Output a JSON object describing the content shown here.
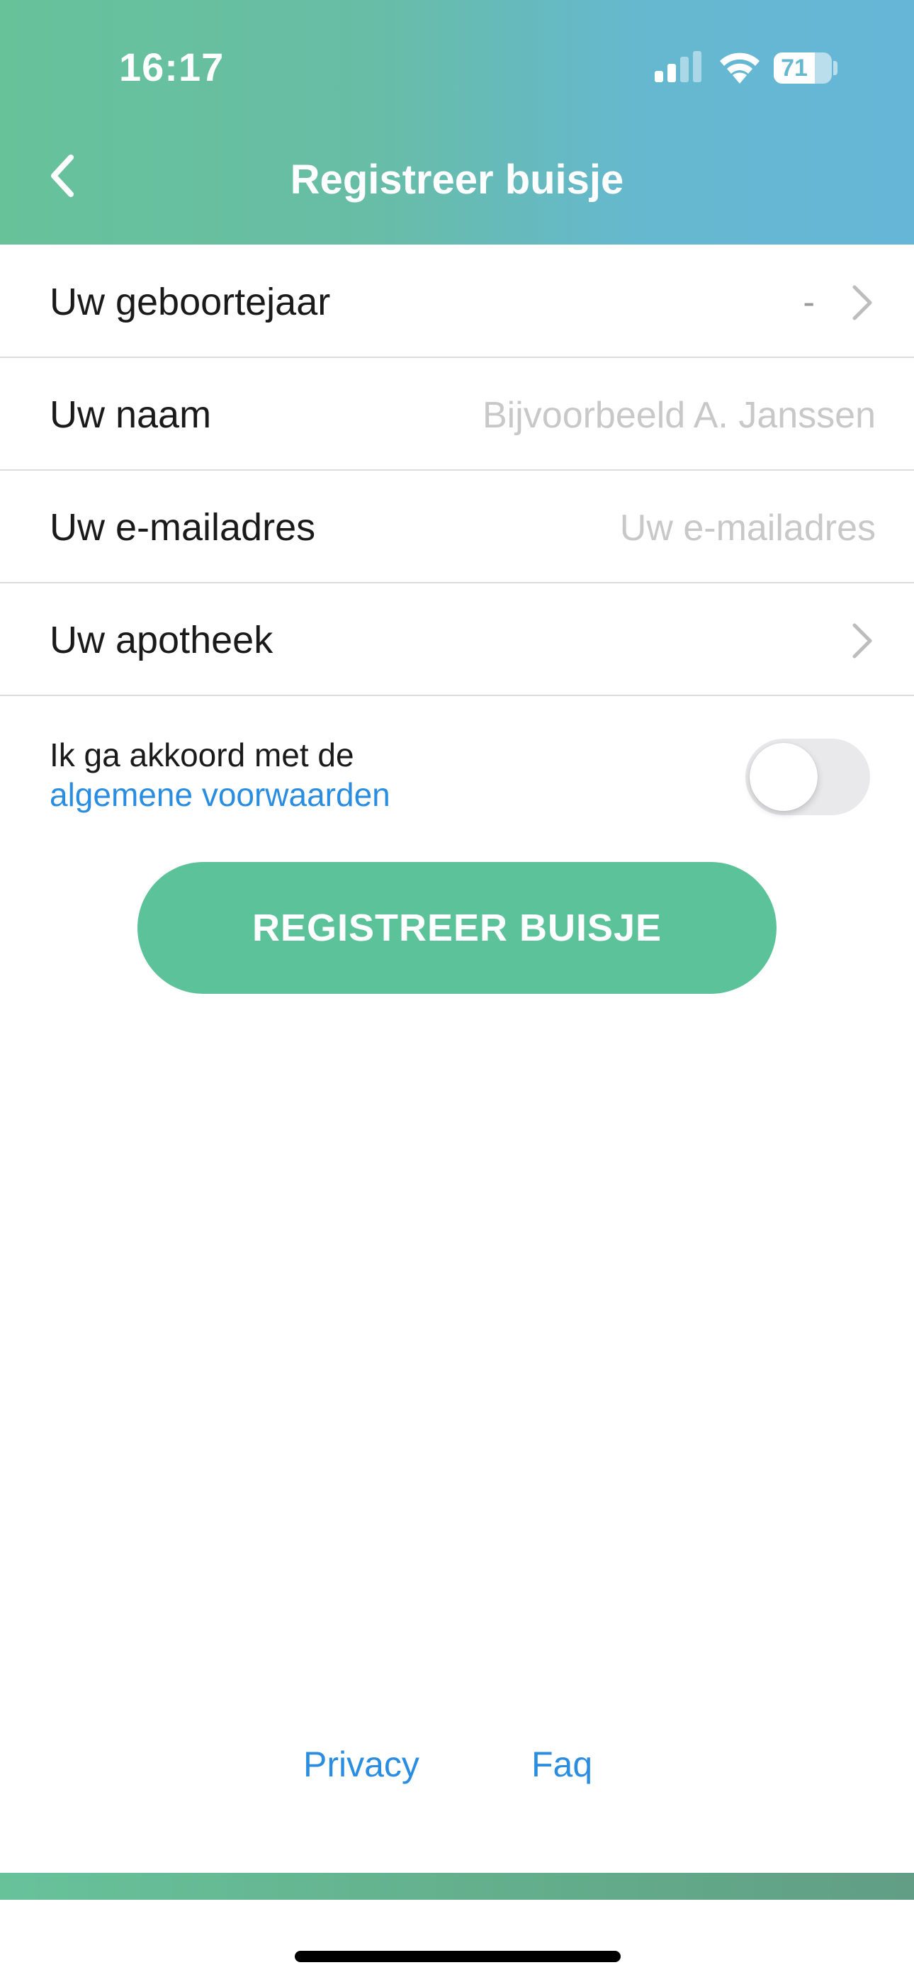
{
  "status_bar": {
    "time": "16:17",
    "battery": "71",
    "icons": [
      "signal-icon",
      "wifi-icon",
      "battery-icon"
    ]
  },
  "header": {
    "title": "Registreer buisje",
    "back_icon": "chevron-left-icon",
    "gradient_colors": [
      "#67c29a",
      "#66b6d8"
    ]
  },
  "form": {
    "birth_year": {
      "label": "Uw geboortejaar",
      "value": "-"
    },
    "name": {
      "label": "Uw naam",
      "placeholder": "Bijvoorbeeld A. Janssen",
      "value": ""
    },
    "email": {
      "label": "Uw e-mailadres",
      "placeholder": "Uw e-mailadres",
      "value": ""
    },
    "pharmacy": {
      "label": "Uw apotheek",
      "value": ""
    }
  },
  "terms": {
    "text": "Ik ga akkoord met de",
    "link": "algemene voorwaarden",
    "accepted": false
  },
  "register_button": {
    "label": "REGISTREER BUISJE",
    "color": "#5bc29a"
  },
  "footer": {
    "privacy": "Privacy",
    "faq": "Faq"
  },
  "colors": {
    "link": "#2a8de0"
  }
}
